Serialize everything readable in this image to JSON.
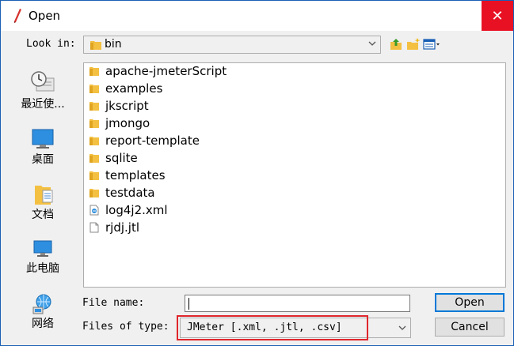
{
  "window": {
    "title": "Open",
    "close_glyph": "✕"
  },
  "lookin": {
    "label": "Look in:",
    "value": "bin"
  },
  "places": [
    {
      "label": "最近使...",
      "icon": "recent-items-icon"
    },
    {
      "label": "桌面",
      "icon": "desktop-icon"
    },
    {
      "label": "文档",
      "icon": "documents-icon"
    },
    {
      "label": "此电脑",
      "icon": "this-pc-icon"
    },
    {
      "label": "网络",
      "icon": "network-icon"
    }
  ],
  "files": [
    {
      "name": "apache-jmeterScript",
      "type": "folder"
    },
    {
      "name": "examples",
      "type": "folder"
    },
    {
      "name": "jkscript",
      "type": "folder"
    },
    {
      "name": "jmongo",
      "type": "folder"
    },
    {
      "name": "report-template",
      "type": "folder"
    },
    {
      "name": "sqlite",
      "type": "folder"
    },
    {
      "name": "templates",
      "type": "folder"
    },
    {
      "name": "testdata",
      "type": "folder"
    },
    {
      "name": "log4j2.xml",
      "type": "xml"
    },
    {
      "name": "rjdj.jtl",
      "type": "file"
    }
  ],
  "filename": {
    "label": "File name:",
    "value": ""
  },
  "filetype": {
    "label": "Files of type:",
    "value": "JMeter [.xml, .jtl, .csv]"
  },
  "buttons": {
    "open": "Open",
    "cancel": "Cancel"
  },
  "colors": {
    "accent": "#0078d7",
    "close": "#e81123",
    "highlight": "#e0262c",
    "folder": "#f3c042"
  }
}
